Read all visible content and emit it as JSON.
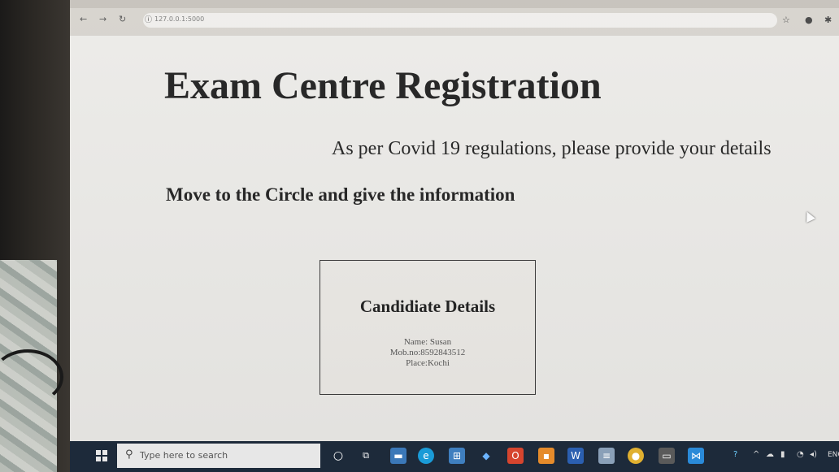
{
  "browser": {
    "url": "127.0.0.1:5000",
    "back_icon": "back-arrow-icon",
    "forward_icon": "forward-arrow-icon",
    "reload_icon": "reload-icon"
  },
  "page": {
    "title": "Exam Centre Registration",
    "subtitle": "As per Covid 19 regulations, please provide your details",
    "instruction": "Move to the Circle and give the information"
  },
  "card": {
    "title": "Candidiate Details",
    "name_line": "Name: Susan",
    "mobile_line": "Mob.no:8592843512",
    "place_line": "Place:Kochi"
  },
  "taskbar": {
    "search_placeholder": "Type here to search",
    "language": "ENG"
  },
  "colors": {
    "page_background": "#ecebe8",
    "taskbar": "#1d2a3a",
    "text": "#222222"
  }
}
